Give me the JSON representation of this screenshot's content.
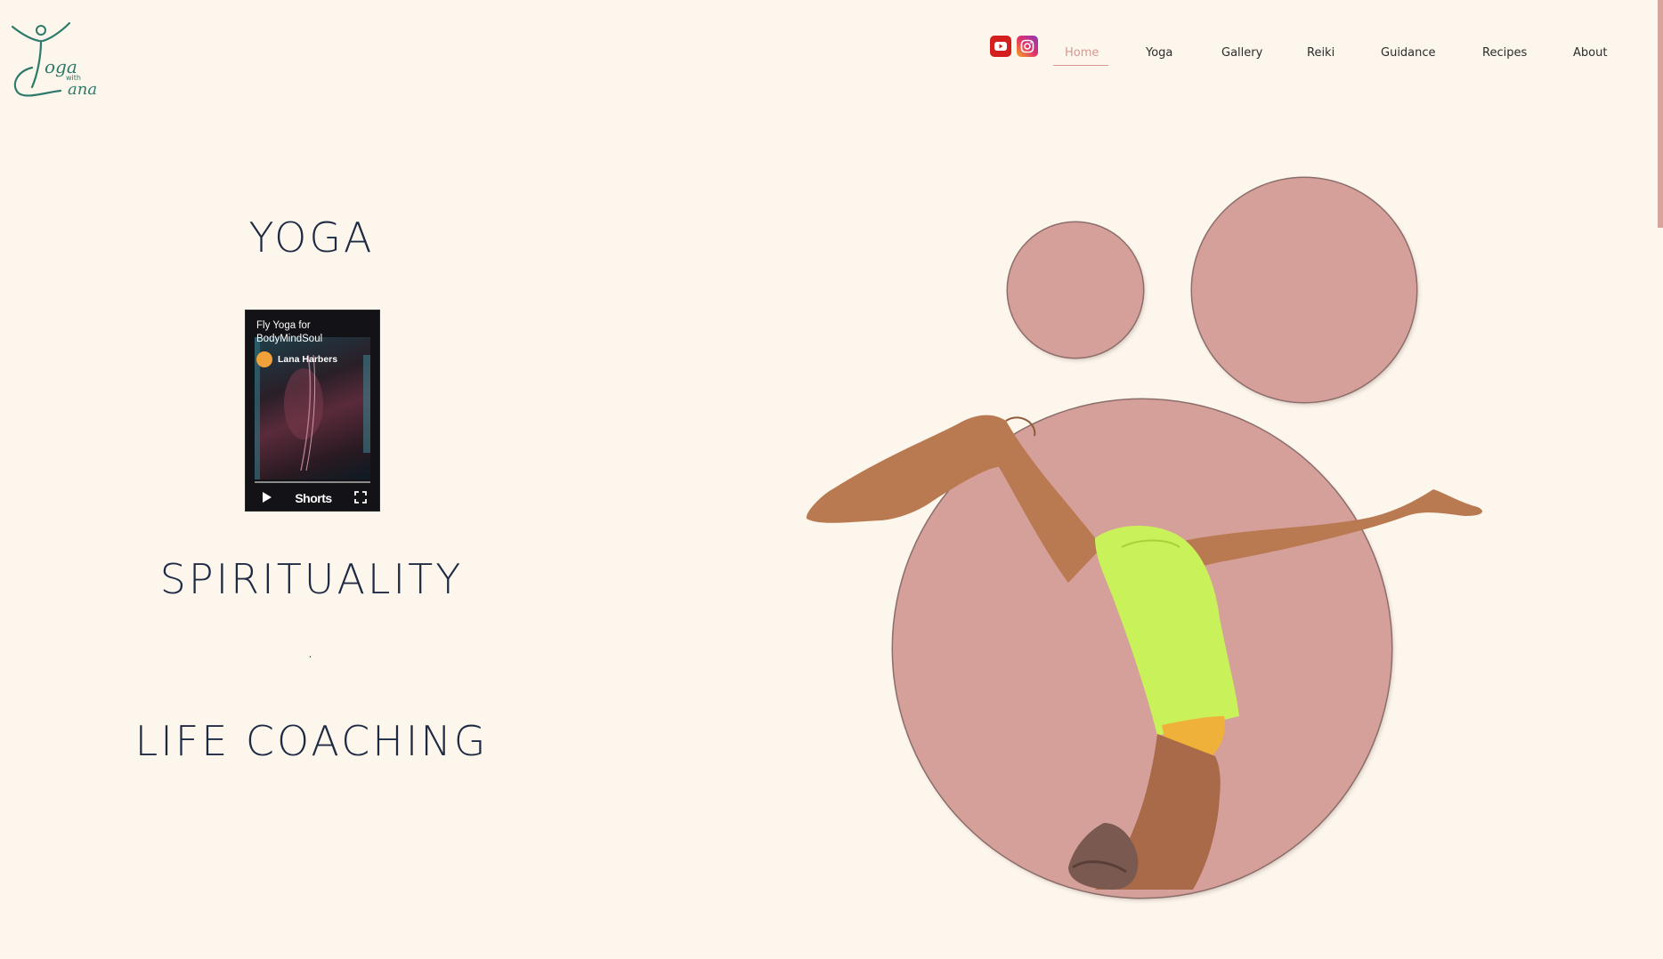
{
  "header": {
    "logo": {
      "text_main": "oga",
      "text_with": "with",
      "text_name": "ana"
    },
    "social": [
      {
        "name": "youtube",
        "icon": "youtube-icon"
      },
      {
        "name": "instagram",
        "icon": "instagram-icon"
      }
    ],
    "nav": [
      {
        "label": "Home",
        "active": true
      },
      {
        "label": "Yoga",
        "active": false
      },
      {
        "label": "Gallery",
        "active": false
      },
      {
        "label": "Reiki",
        "active": false
      },
      {
        "label": "Guidance",
        "active": false
      },
      {
        "label": "Recipes",
        "active": false
      },
      {
        "label": "About",
        "active": false
      }
    ]
  },
  "main": {
    "heading_yoga": "YOGA",
    "heading_spirituality": "SPIRITUALITY",
    "separator": ".",
    "heading_life": "LIFE COACHING",
    "video": {
      "title": "Fly Yoga for BodyMindSoul",
      "channel": "Lana Harbers",
      "shorts_label": "Shorts",
      "play_icon": "play-icon",
      "fullscreen_icon": "fullscreen-icon"
    }
  },
  "colors": {
    "background": "#fdf6ec",
    "accent": "#d8978f",
    "circle": "#d6a09a",
    "heading": "#1e2a44",
    "logo": "#2e7a6a"
  }
}
